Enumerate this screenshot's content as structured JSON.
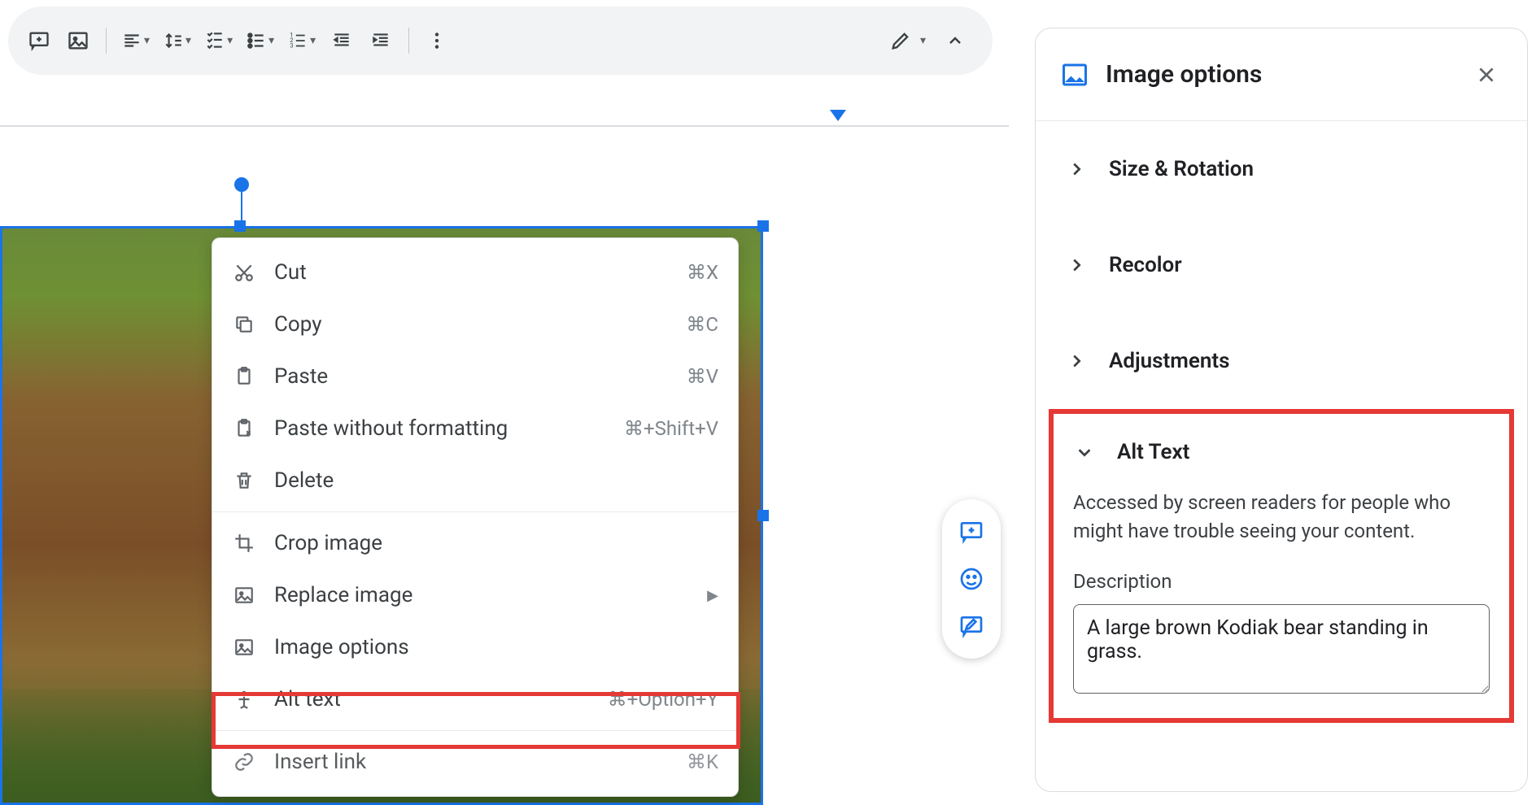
{
  "toolbar": {
    "edit_mode": "Editing"
  },
  "context_menu": {
    "items": [
      {
        "icon": "cut-icon",
        "label": "Cut",
        "shortcut": "⌘X"
      },
      {
        "icon": "copy-icon",
        "label": "Copy",
        "shortcut": "⌘C"
      },
      {
        "icon": "paste-icon",
        "label": "Paste",
        "shortcut": "⌘V"
      },
      {
        "icon": "paste-plain-icon",
        "label": "Paste without formatting",
        "shortcut": "⌘+Shift+V"
      },
      {
        "icon": "delete-icon",
        "label": "Delete",
        "shortcut": ""
      }
    ],
    "group2": [
      {
        "icon": "crop-icon",
        "label": "Crop image",
        "shortcut": "",
        "sub": false
      },
      {
        "icon": "replace-image-icon",
        "label": "Replace image",
        "shortcut": "",
        "sub": true
      },
      {
        "icon": "image-options-icon",
        "label": "Image options",
        "shortcut": "",
        "sub": false
      },
      {
        "icon": "alt-text-icon",
        "label": "Alt text",
        "shortcut": "⌘+Option+Y",
        "sub": false
      }
    ],
    "group3": [
      {
        "icon": "link-icon",
        "label": "Insert link",
        "shortcut": "⌘K"
      }
    ]
  },
  "sidebar": {
    "title": "Image options",
    "sections": {
      "size": "Size & Rotation",
      "recolor": "Recolor",
      "adjustments": "Adjustments",
      "alt_text": "Alt Text"
    },
    "alt": {
      "help": "Accessed by screen readers for people who might have trouble seeing your content.",
      "field_label": "Description",
      "value": "A large brown Kodiak bear standing in grass."
    }
  }
}
